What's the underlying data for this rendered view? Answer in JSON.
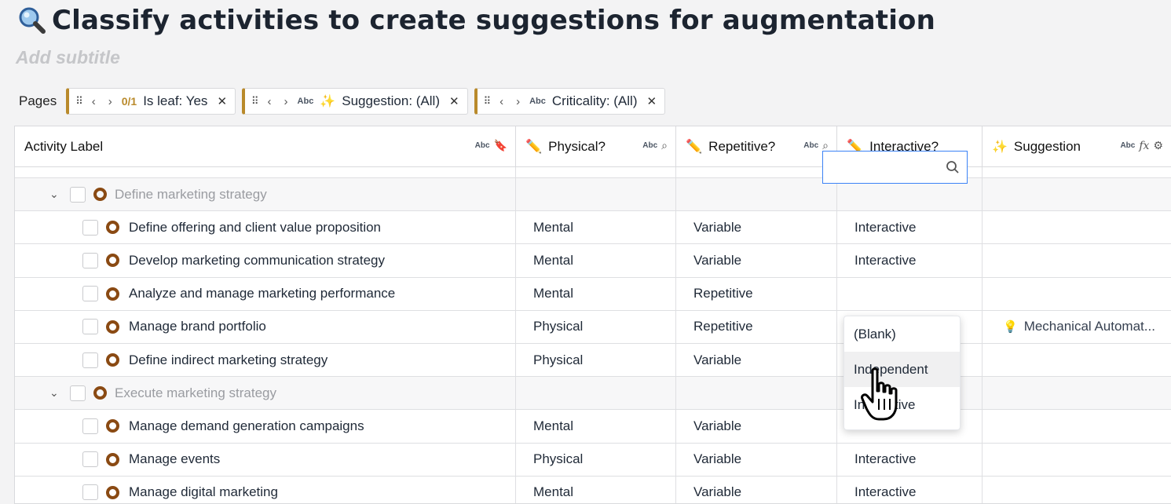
{
  "page": {
    "title": "Classify activities to create suggestions for augmentation",
    "subtitle_placeholder": "Add subtitle"
  },
  "filters": {
    "label": "Pages",
    "chips": [
      {
        "count": "0/1",
        "text": "Is leaf: Yes"
      },
      {
        "type": "Abc",
        "text": "Suggestion: (All)"
      },
      {
        "type": "Abc",
        "text": "Criticality: (All)"
      }
    ]
  },
  "table": {
    "columns": [
      {
        "label": "Activity Label",
        "type": "Abc"
      },
      {
        "label": "Physical?",
        "type": "Abc"
      },
      {
        "label": "Repetitive?",
        "type": "Abc"
      },
      {
        "label": "Interactive?"
      },
      {
        "label": "Suggestion",
        "type": "Abc"
      }
    ],
    "rows": [
      {
        "group": true,
        "label": "Define marketing strategy",
        "physical": "",
        "repetitive": "",
        "interactive": "",
        "suggestion": ""
      },
      {
        "label": "Define offering and client value proposition",
        "physical": "Mental",
        "repetitive": "Variable",
        "interactive": "Interactive",
        "suggestion": ""
      },
      {
        "label": "Develop marketing communication strategy",
        "physical": "Mental",
        "repetitive": "Variable",
        "interactive": "Interactive",
        "suggestion": ""
      },
      {
        "label": "Analyze and manage marketing performance",
        "physical": "Mental",
        "repetitive": "Repetitive",
        "interactive": "",
        "suggestion": ""
      },
      {
        "label": "Manage brand portfolio",
        "physical": "Physical",
        "repetitive": "Repetitive",
        "interactive": "",
        "suggestion": "Mechanical Automat..."
      },
      {
        "label": "Define indirect marketing strategy",
        "physical": "Physical",
        "repetitive": "Variable",
        "interactive": "",
        "suggestion": ""
      },
      {
        "group": true,
        "label": "Execute marketing strategy",
        "physical": "",
        "repetitive": "",
        "interactive": "",
        "suggestion": ""
      },
      {
        "label": "Manage demand generation campaigns",
        "physical": "Mental",
        "repetitive": "Variable",
        "interactive": "",
        "suggestion": ""
      },
      {
        "label": "Manage events",
        "physical": "Physical",
        "repetitive": "Variable",
        "interactive": "Interactive",
        "suggestion": ""
      },
      {
        "label": "Manage digital marketing",
        "physical": "Mental",
        "repetitive": "Variable",
        "interactive": "Interactive",
        "suggestion": ""
      }
    ]
  },
  "dropdown": {
    "options": [
      "(Blank)",
      "Independent",
      "Interactive"
    ]
  }
}
